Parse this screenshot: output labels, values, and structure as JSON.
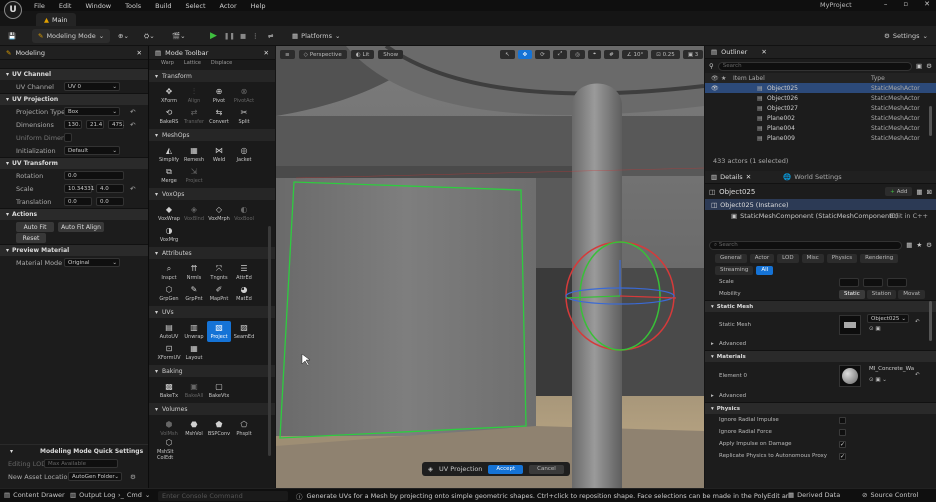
{
  "app": {
    "logo": "U",
    "menus": [
      "File",
      "Edit",
      "Window",
      "Tools",
      "Build",
      "Select",
      "Actor",
      "Help"
    ],
    "project": "MyProject",
    "window_controls": [
      "minimize-icon",
      "maximize-icon",
      "close-icon"
    ]
  },
  "tab": {
    "label": "Main"
  },
  "toolbar": {
    "mode": "Modeling Mode",
    "platforms": "Platforms",
    "settings": "Settings"
  },
  "left": {
    "tab": "Modeling",
    "uv_channel": {
      "title": "UV Channel",
      "label": "UV Channel",
      "value": "UV 0"
    },
    "uv_projection": {
      "title": "UV Projection",
      "projection_type_label": "Projection Type",
      "projection_type": "Box",
      "dimensions_label": "Dimensions",
      "dim": [
        "130.",
        "21.4",
        "475."
      ],
      "uniform_label": "Uniform Dimen...",
      "init_label": "Initialization",
      "init": "Default"
    },
    "uv_transform": {
      "title": "UV Transform",
      "rotation_label": "Rotation",
      "rotation": "0.0",
      "scale_label": "Scale",
      "scale": [
        "10.34331",
        "4.0"
      ],
      "translation_label": "Translation",
      "translation": [
        "0.0",
        "0.0"
      ]
    },
    "actions": {
      "title": "Actions",
      "auto_fit": "Auto Fit",
      "auto_fit_align": "Auto Fit Align",
      "reset": "Reset"
    },
    "preview": {
      "title": "Preview Material",
      "label": "Material Mode",
      "value": "Original"
    },
    "quick": {
      "title": "Modeling Mode Quick Settings",
      "lod_label": "Editing LOD",
      "lod": "Max Available",
      "asset_label": "New Asset Location",
      "asset": "AutoGen Folder"
    }
  },
  "modetoolbar": {
    "tab": "Mode Toolbar",
    "top_partial": [
      "Warp",
      "Lattice",
      "Displace"
    ],
    "categories": [
      {
        "name": "Transform",
        "tools": [
          {
            "label": "XForm",
            "icon": "xform-icon"
          },
          {
            "label": "Align",
            "icon": "align-icon",
            "dim": true
          },
          {
            "label": "Pivot",
            "icon": "pivot-icon"
          },
          {
            "label": "PivotAct",
            "icon": "pivot-actor-icon",
            "dim": true
          },
          {
            "label": "BakeRS",
            "icon": "bake-rs-icon"
          },
          {
            "label": "Transfer",
            "icon": "transfer-icon",
            "dim": true
          },
          {
            "label": "Convert",
            "icon": "convert-icon"
          },
          {
            "label": "Split",
            "icon": "split-icon"
          }
        ]
      },
      {
        "name": "MeshOps",
        "tools": [
          {
            "label": "Simplify",
            "icon": "simplify-icon"
          },
          {
            "label": "Remesh",
            "icon": "remesh-icon"
          },
          {
            "label": "Weld",
            "icon": "weld-icon"
          },
          {
            "label": "Jacket",
            "icon": "jacket-icon"
          },
          {
            "label": "Merge",
            "icon": "merge-icon"
          },
          {
            "label": "Project",
            "icon": "project-icon",
            "dim": true
          }
        ]
      },
      {
        "name": "VoxOps",
        "tools": [
          {
            "label": "VoxWrap",
            "icon": "voxwrap-icon"
          },
          {
            "label": "VoxBlnd",
            "icon": "voxblend-icon",
            "dim": true
          },
          {
            "label": "VoxMrph",
            "icon": "voxmorph-icon"
          },
          {
            "label": "VoxBool",
            "icon": "voxbool-icon",
            "dim": true
          },
          {
            "label": "VoxMrg",
            "icon": "voxmerge-icon"
          }
        ]
      },
      {
        "name": "Attributes",
        "tools": [
          {
            "label": "Inspct",
            "icon": "inspect-icon"
          },
          {
            "label": "Nrmls",
            "icon": "normals-icon"
          },
          {
            "label": "Tngnts",
            "icon": "tangents-icon"
          },
          {
            "label": "AttrEd",
            "icon": "attr-edit-icon"
          },
          {
            "label": "GrpGen",
            "icon": "group-gen-icon"
          },
          {
            "label": "GrpPnt",
            "icon": "group-paint-icon"
          },
          {
            "label": "MapPnt",
            "icon": "map-paint-icon"
          },
          {
            "label": "MatEd",
            "icon": "mat-edit-icon"
          }
        ]
      },
      {
        "name": "UVs",
        "tools": [
          {
            "label": "AutoUV",
            "icon": "auto-uv-icon"
          },
          {
            "label": "Unwrap",
            "icon": "unwrap-icon"
          },
          {
            "label": "Project",
            "icon": "uv-project-icon",
            "selected": true
          },
          {
            "label": "SeamEd",
            "icon": "seam-edit-icon"
          },
          {
            "label": "XFormUV",
            "icon": "xform-uv-icon"
          },
          {
            "label": "Layout",
            "icon": "layout-icon"
          }
        ]
      },
      {
        "name": "Baking",
        "tools": [
          {
            "label": "BakeTx",
            "icon": "bake-tex-icon"
          },
          {
            "label": "BakeAll",
            "icon": "bake-all-icon",
            "dim": true
          },
          {
            "label": "BakeVtx",
            "icon": "bake-vtx-icon"
          }
        ]
      },
      {
        "name": "Volumes",
        "tools": [
          {
            "label": "VolMsh",
            "icon": "vol-mesh-icon",
            "dim": true
          },
          {
            "label": "MshVol",
            "icon": "mesh-vol-icon"
          },
          {
            "label": "BSPConv",
            "icon": "bsp-conv-icon"
          },
          {
            "label": "Phsplt",
            "icon": "physics-icon"
          },
          {
            "label": "MshSlt ColEdt",
            "icon": "collision-icon"
          }
        ]
      }
    ]
  },
  "viewport": {
    "perspective": "Perspective",
    "lit": "Lit",
    "show": "Show",
    "snap_angle": "10°",
    "snap_scale": "0.25",
    "cam_speed": "3",
    "accept_label": "UV Projection",
    "accept": "Accept",
    "cancel": "Cancel"
  },
  "outliner": {
    "title": "Outliner",
    "search_placeholder": "Search",
    "col_label": "Item Label",
    "col_type": "Type",
    "rows": [
      {
        "label": "Object025",
        "type": "StaticMeshActor",
        "selected": true
      },
      {
        "label": "Object026",
        "type": "StaticMeshActor"
      },
      {
        "label": "Object027",
        "type": "StaticMeshActor"
      },
      {
        "label": "Plane002",
        "type": "StaticMeshActor"
      },
      {
        "label": "Plane004",
        "type": "StaticMeshActor"
      },
      {
        "label": "Plane009",
        "type": "StaticMeshActor"
      }
    ],
    "status": "433 actors (1 selected)"
  },
  "details": {
    "title": "Details",
    "world_settings": "World Settings",
    "object": "Object025",
    "add": "Add",
    "instance": "Object025 (Instance)",
    "component": "StaticMeshComponent (StaticMeshComponent0)",
    "edit_cpp": "Edit in C++",
    "search_placeholder": "Search",
    "filters_row1": [
      "General",
      "Actor",
      "LOD",
      "Misc",
      "Physics",
      "Rendering"
    ],
    "filters_row2": [
      "Streaming",
      "All"
    ],
    "scale_label": "Scale",
    "mobility_label": "Mobility",
    "mobility": [
      "Static",
      "Station",
      "Movat"
    ],
    "static_mesh_section": "Static Mesh",
    "static_mesh_label": "Static Mesh",
    "static_mesh_value": "Object025",
    "advanced": "Advanced",
    "materials_section": "Materials",
    "element_label": "Element 0",
    "material_value": "MI_Concrete_Wa",
    "physics_section": "Physics",
    "physics_rows": [
      {
        "label": "Ignore Radial Impulse",
        "checked": false
      },
      {
        "label": "Ignore Radial Force",
        "checked": false
      },
      {
        "label": "Apply Impulse on Damage",
        "checked": true
      },
      {
        "label": "Replicate Physics to Autonomous Proxy",
        "checked": true
      }
    ]
  },
  "statusbar": {
    "content_drawer": "Content Drawer",
    "output_log": "Output Log",
    "cmd": "Cmd",
    "console_placeholder": "Enter Console Command",
    "hint": "Generate UVs for a Mesh by projecting onto simple geometric shapes. Ctrl+click to reposition shape. Face selections can be made in the PolyEdit and TriEdit Tools.",
    "derived": "Derived Data",
    "source": "Source Control"
  }
}
